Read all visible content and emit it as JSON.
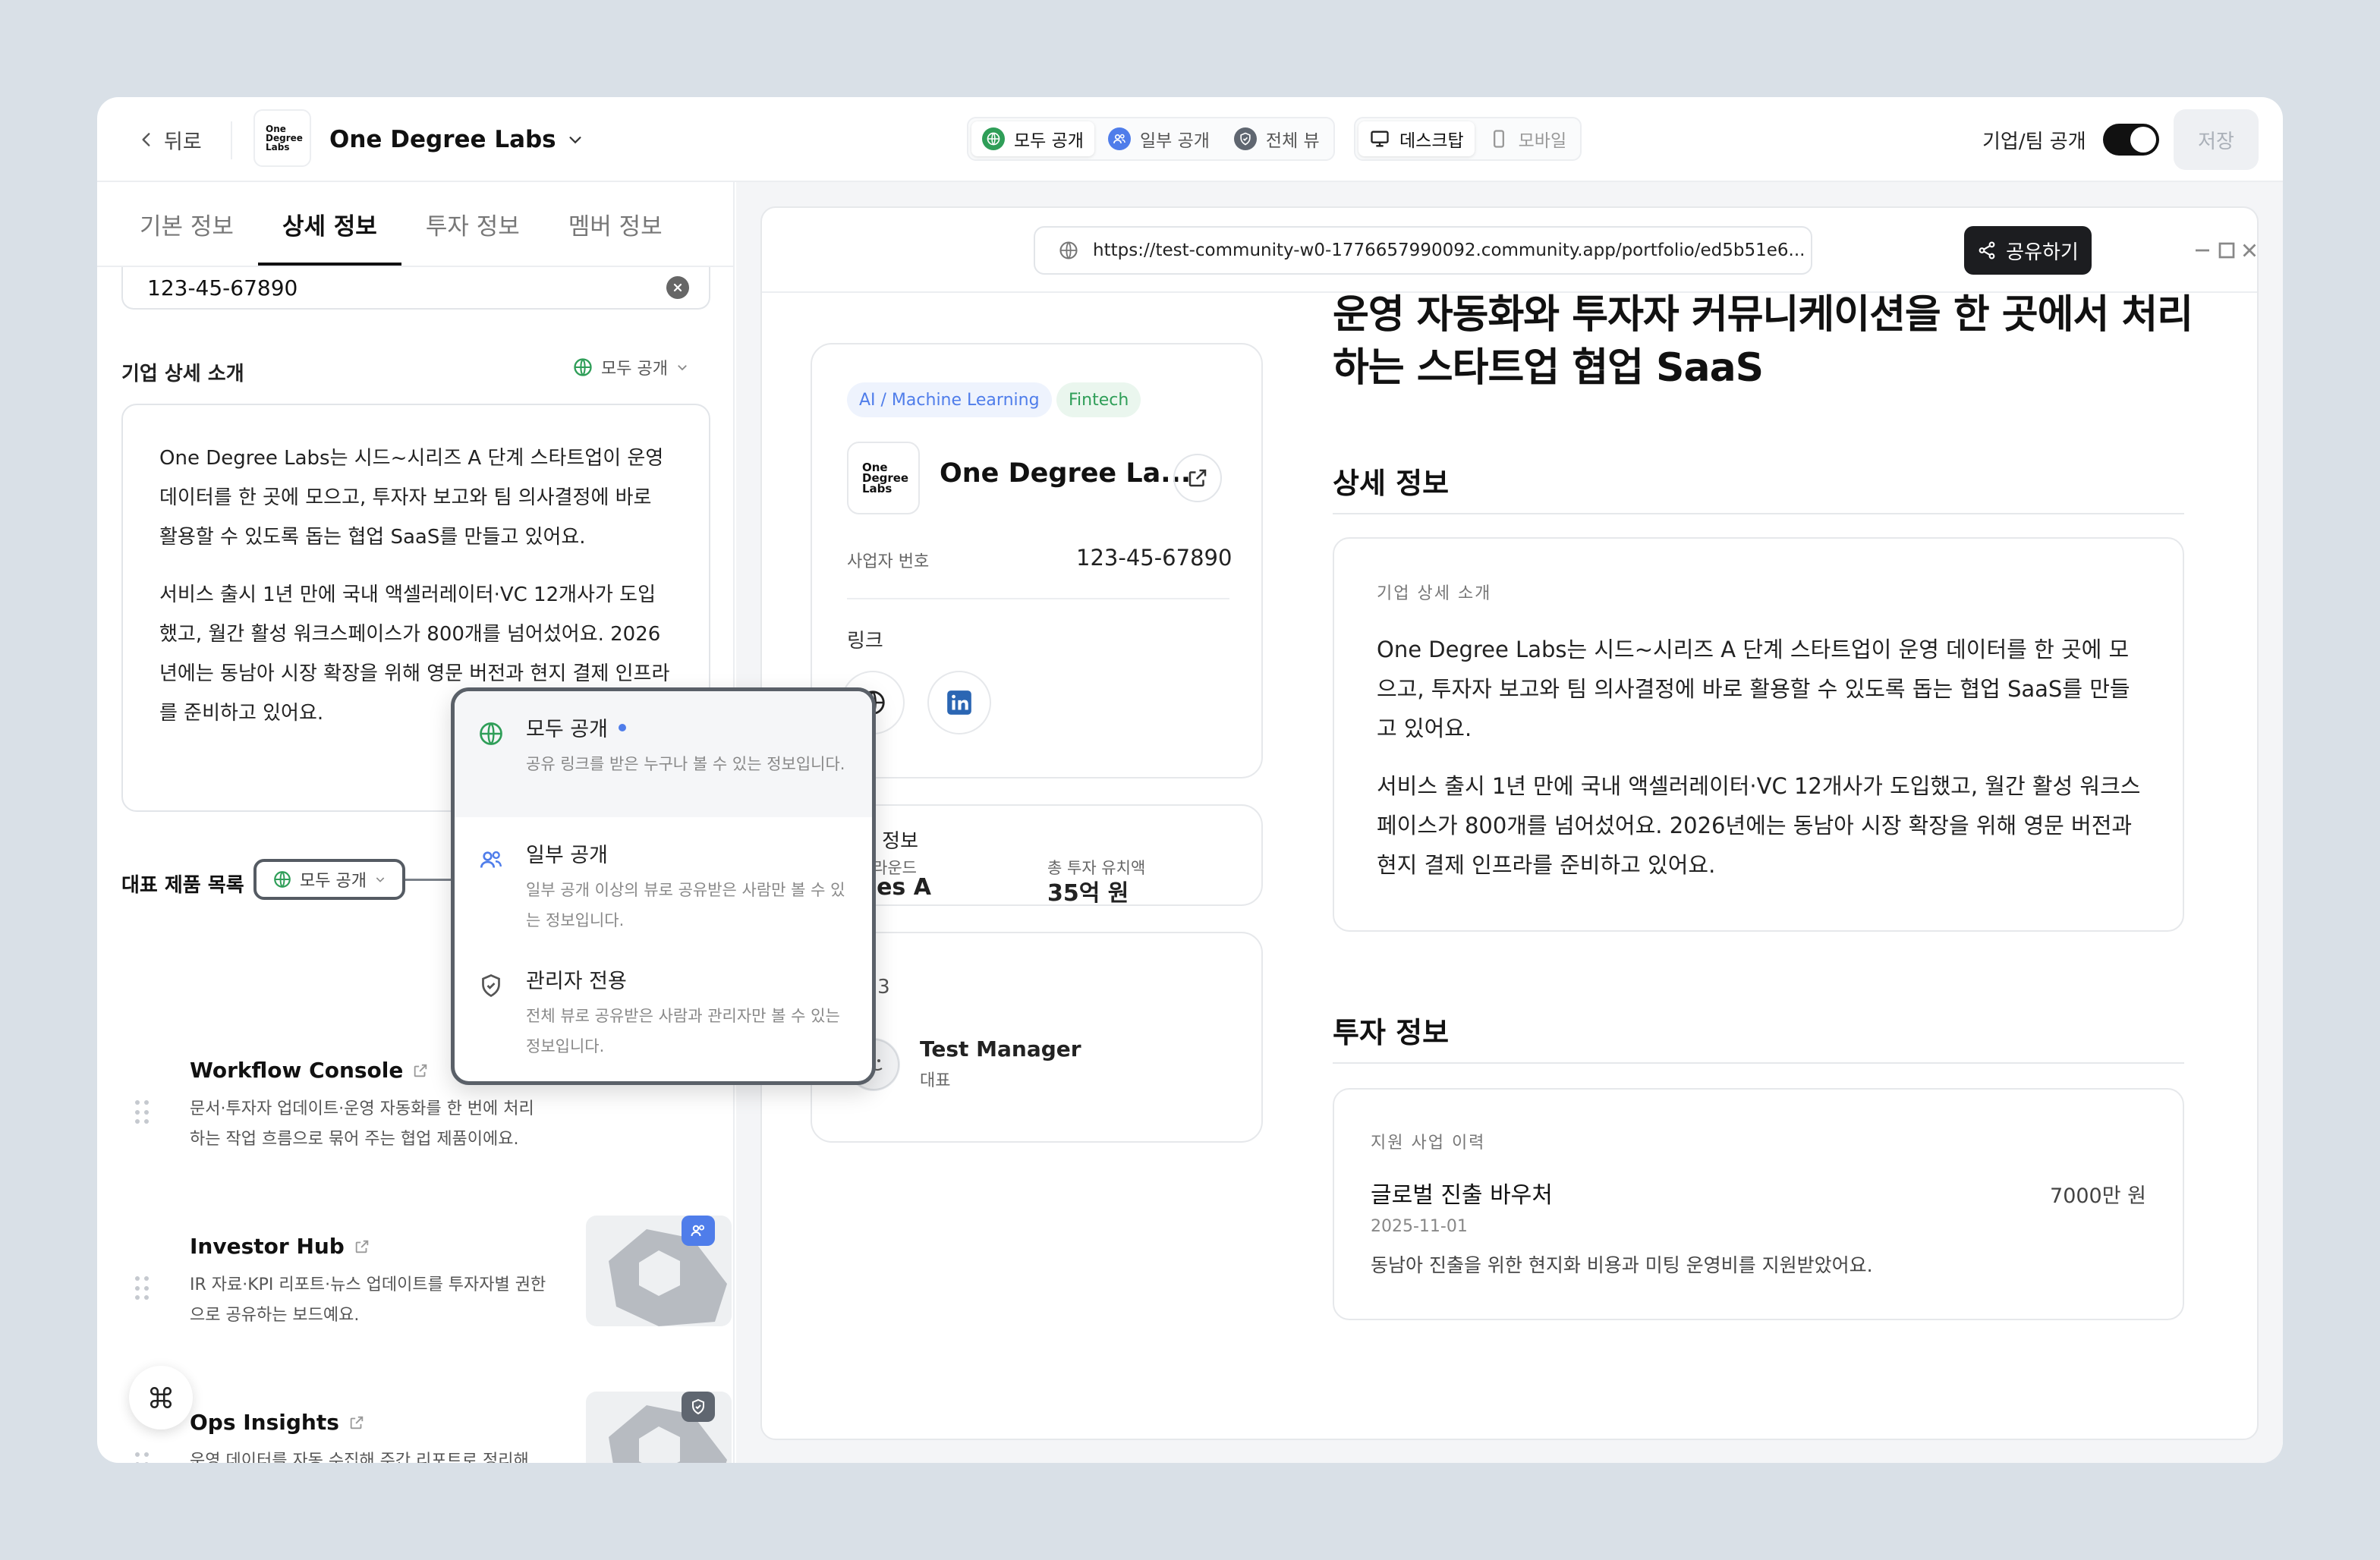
{
  "topbar": {
    "back_label": "뒤로",
    "logo_lines": [
      "One",
      "Degree",
      "Labs"
    ],
    "company_name": "One Degree Labs",
    "visibility_options": [
      "모두 공개",
      "일부 공개",
      "전체 뷰"
    ],
    "device_options": [
      "데스크탑",
      "모바일"
    ],
    "team_public_label": "기업/팀 공개",
    "save_label": "저장"
  },
  "left": {
    "tabs": [
      "기본 정보",
      "상세 정보",
      "투자 정보",
      "멤버 정보"
    ],
    "business_number_value": "123-45-67890",
    "detail_section_label": "기업 상세 소개",
    "detail_visibility": "모두 공개",
    "detail_paragraphs": [
      "One Degree Labs는 시드~시리즈 A 단계 스타트업이 운영 데이터를 한 곳에 모으고, 투자자 보고와 팀 의사결정에 바로 활용할 수 있도록 돕는 협업 SaaS를 만들고 있어요.",
      "서비스 출시 1년 만에 국내 액셀러레이터·VC 12개사가 도입했고, 월간 활성 워크스페이스가 800개를 넘어섰어요. 2026년에는 동남아 시장 확장을 위해 영문 버전과 현지 결제 인프라를 준비하고 있어요."
    ],
    "products_label": "대표 제품 목록",
    "products_visibility": "모두 공개",
    "products": [
      {
        "name": "Workflow Console",
        "desc": "문서·투자자 업데이트·운영 자동화를 한 번에 처리하는 작업 흐름으로 묶어 주는 협업 제품이에요.",
        "badge": ""
      },
      {
        "name": "Investor Hub",
        "desc": "IR 자료·KPI 리포트·뉴스 업데이트를 투자자별 권한으로 공유하는 보드예요.",
        "badge": "partial"
      },
      {
        "name": "Ops Insights",
        "desc": "운영 데이터를 자동 수집해 주간 리포트로 정리해 주는 분석 모듈이에요.",
        "badge": "admin"
      }
    ]
  },
  "dropdown": {
    "items": [
      {
        "title": "모두 공개",
        "desc": "공유 링크를 받은 누구나 볼 수 있는 정보입니다."
      },
      {
        "title": "일부 공개",
        "desc": "일부 공개 이상의 뷰로 공유받은 사람만 볼 수 있는 정보입니다."
      },
      {
        "title": "관리자 전용",
        "desc": "전체 뷰로 공유받은 사람과 관리자만 볼 수 있는 정보입니다."
      }
    ]
  },
  "preview": {
    "url": "https://test-community-w0-1776657990092.community.app/portfolio/ed5b51e6...",
    "share_label": "공유하기",
    "tags": [
      "AI / Machine Learning",
      "Fintech"
    ],
    "company_name": "One Degree La...",
    "biz_label": "사업자 번호",
    "biz_value": "123-45-67890",
    "links_label": "링크",
    "invest_card_title": "자 정보",
    "round_label": "라운드",
    "round_value": "ries A",
    "total_label": "총 투자 유치액",
    "total_value": "35억 원",
    "team_label": "팀 3",
    "member_name": "Test Manager",
    "member_role": "대표",
    "headline": "운영 자동화와 투자자 커뮤니케이션을 한 곳에서 처리하는 스타트업 협업 SaaS",
    "detail_heading": "상세 정보",
    "detail_box_label": "기업 상세 소개",
    "detail_paragraphs": [
      "One Degree Labs는 시드~시리즈 A 단계 스타트업이 운영 데이터를 한 곳에 모으고, 투자자 보고와 팀 의사결정에 바로 활용할 수 있도록 돕는 협업 SaaS를 만들고 있어요.",
      "서비스 출시 1년 만에 국내 액셀러레이터·VC 12개사가 도입했고, 월간 활성 워크스페이스가 800개를 넘어섰어요. 2026년에는 동남아 시장 확장을 위해 영문 버전과 현지 결제 인프라를 준비하고 있어요."
    ],
    "invest_heading": "투자 정보",
    "support_label": "지원 사업 이력",
    "support_title": "글로벌 진출 바우처",
    "support_amount": "7000만 원",
    "support_date": "2025-11-01",
    "support_desc": "동남아 진출을 위한 현지화 비용과 미팅 운영비를 지원받았어요."
  },
  "colors": {
    "accent_blue": "#4f7dea",
    "public_green": "#2f9e58",
    "dark": "#1c1d20"
  }
}
